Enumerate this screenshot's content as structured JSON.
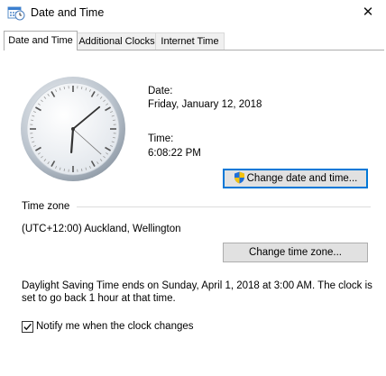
{
  "window": {
    "title": "Date and Time",
    "close_symbol": "✕",
    "icon": "date-time-calendar-icon"
  },
  "tabs": [
    {
      "label": "Date and Time",
      "active": true
    },
    {
      "label": "Additional Clocks",
      "active": false
    },
    {
      "label": "Internet Time",
      "active": false
    }
  ],
  "clock": {
    "hour": 6,
    "minute": 8,
    "second": 22
  },
  "date": {
    "label": "Date:",
    "value": "Friday, January 12, 2018"
  },
  "time": {
    "label": "Time:",
    "value": "6:08:22 PM"
  },
  "buttons": {
    "change_datetime": "Change date and time...",
    "change_timezone": "Change time zone..."
  },
  "timezone": {
    "section_label": "Time zone",
    "value": "(UTC+12:00) Auckland, Wellington"
  },
  "dst": {
    "line1": "Daylight Saving Time ends on Sunday, April 1, 2018 at 3:00 AM. The clock is",
    "line2": "set to go back 1 hour at that time."
  },
  "notify": {
    "label": "Notify me when the clock changes",
    "checked": true
  },
  "colors": {
    "focus_blue": "#0078d7",
    "shield_blue": "#1e6fd9",
    "shield_yellow": "#f4c20d"
  }
}
